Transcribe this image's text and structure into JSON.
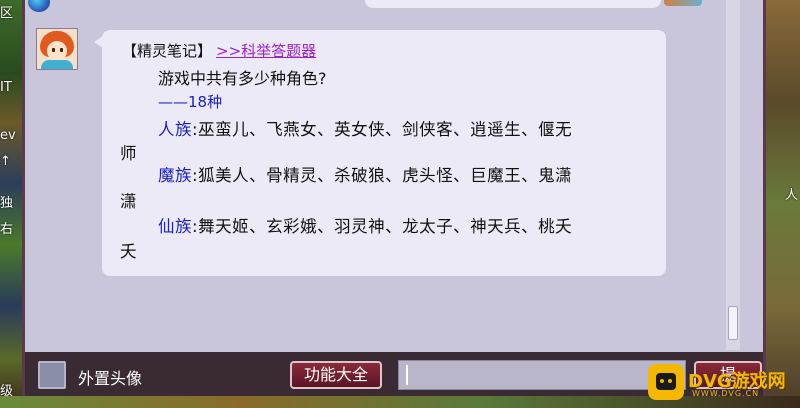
{
  "background": {
    "left_fragments": [
      "区",
      "IT",
      "ev",
      "↑",
      "独",
      "右",
      "级"
    ],
    "right_fragments": [
      "人"
    ]
  },
  "note": {
    "title": "【精灵笔记】",
    "link": ">>科举答题器",
    "question": "游戏中共有多少种角色?",
    "answer": "——18种",
    "separator": ":",
    "rows": [
      {
        "race": "人族",
        "roles": "巫蛮儿、飞燕女、英女侠、剑侠客、逍遥生、偃无",
        "wrap": "师"
      },
      {
        "race": "魔族",
        "roles": "狐美人、骨精灵、杀破狼、虎头怪、巨魔王、鬼潇",
        "wrap": "潇"
      },
      {
        "race": "仙族",
        "roles": "舞天姬、玄彩娥、羽灵神、龙太子、神天兵、桃夭",
        "wrap": "夭"
      }
    ]
  },
  "toolbar": {
    "avatar_toggle_label": "外置头像",
    "functions_button": "功能大全",
    "input_value": "",
    "send_button": "提"
  },
  "watermark": {
    "text": "DVG游戏网",
    "sub": "WWW.DVG.CN"
  },
  "colors": {
    "race": "#1a20c8",
    "link": "#a020d0",
    "bubble": "#eceaf6",
    "window": "#c9c6dc"
  }
}
